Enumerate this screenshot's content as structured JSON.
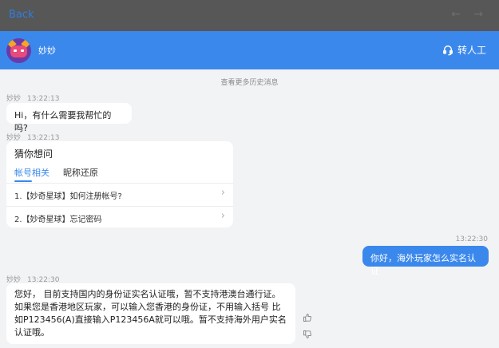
{
  "topbar": {
    "back_label": "Back",
    "arrows": "← →"
  },
  "header": {
    "bot_name": "妙妙",
    "transfer_label": "转人工"
  },
  "history_link": "查看更多历史消息",
  "messages": [
    {
      "sender": "妙妙",
      "time": "13:22:13",
      "text": "Hi，有什么需要我帮忙的吗?"
    },
    {
      "sender": "妙妙",
      "time": "13:22:13"
    },
    {
      "time": "13:22:30",
      "text": "你好，海外玩家怎么实名认证"
    },
    {
      "sender": "妙妙",
      "time": "13:22:30",
      "text": "您好， 目前支持国内的身份证实名认证哦，暂不支持港澳台通行证。如果您是香港地区玩家，可以输入您香港的身份证，不用输入括号 比如P123456(A)直接输入P123456A就可以哦。暂不支持海外用户实名认证哦。"
    }
  ],
  "guess_card": {
    "title": "猜你想问",
    "tabs": [
      "帐号相关",
      "昵称还原"
    ],
    "questions": [
      "1.【妙奇星球】如何注册帐号?",
      "2.【妙奇星球】忘记密码"
    ]
  },
  "icons": {
    "headset": "headset-icon",
    "chevron": "chevron-right-icon",
    "like": "thumbs-up-icon",
    "dislike": "thumbs-down-icon"
  },
  "colors": {
    "accent": "#3b88ec",
    "topbar": "#575757",
    "background": "#f2f3f5"
  }
}
